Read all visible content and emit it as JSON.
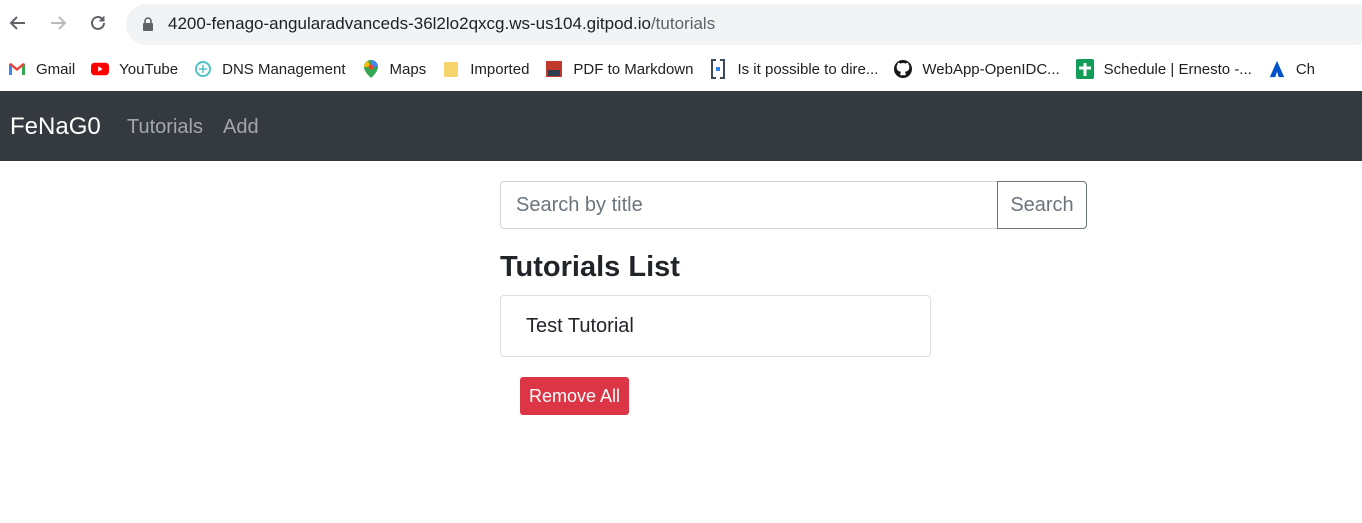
{
  "browser": {
    "url_host": "4200-fenago-angularadvanceds-36l2lo2qxcg.ws-us104.gitpod.io",
    "url_path": "/tutorials"
  },
  "bookmarks": [
    {
      "label": "Gmail",
      "icon": "gmail-icon"
    },
    {
      "label": "YouTube",
      "icon": "youtube-icon"
    },
    {
      "label": "DNS Management",
      "icon": "dns-icon"
    },
    {
      "label": "Maps",
      "icon": "maps-icon"
    },
    {
      "label": "Imported",
      "icon": "folder-icon"
    },
    {
      "label": "PDF to Markdown",
      "icon": "pdf-icon"
    },
    {
      "label": "Is it possible to dire...",
      "icon": "bracket-icon"
    },
    {
      "label": "WebApp-OpenIDC...",
      "icon": "github-icon"
    },
    {
      "label": "Schedule | Ernesto -...",
      "icon": "sheets-icon"
    },
    {
      "label": "Ch",
      "icon": "atlassian-icon"
    }
  ],
  "navbar": {
    "brand": "FeNaG0",
    "links": [
      "Tutorials",
      "Add"
    ]
  },
  "search": {
    "placeholder": "Search by title",
    "value": "",
    "button_label": "Search"
  },
  "tutorials": {
    "title": "Tutorials List",
    "items": [
      "Test Tutorial"
    ],
    "remove_all_label": "Remove All"
  },
  "colors": {
    "navbar_bg": "#343a40",
    "danger": "#dc3545"
  }
}
